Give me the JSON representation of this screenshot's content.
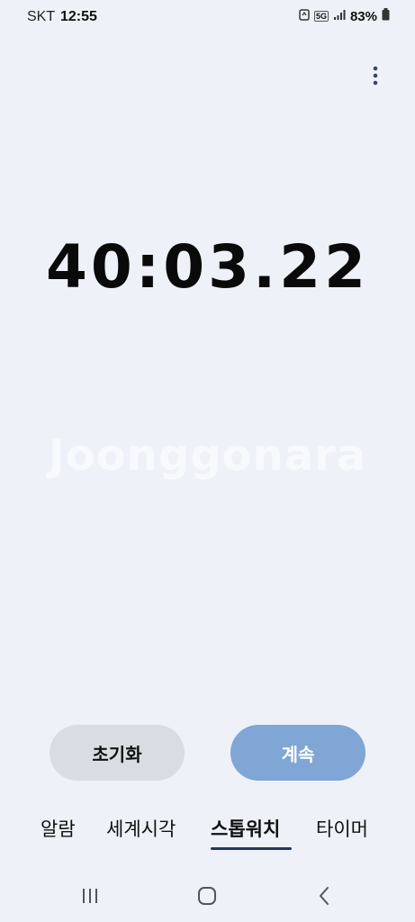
{
  "status_bar": {
    "carrier": "SKT",
    "time": "12:55",
    "network": "5G",
    "battery": "83%"
  },
  "stopwatch": {
    "elapsed": "40:03.22"
  },
  "watermark": "Joonggonara",
  "buttons": {
    "reset_label": "초기화",
    "continue_label": "계속"
  },
  "tabs": [
    {
      "label": "알람",
      "selected": false
    },
    {
      "label": "세계시각",
      "selected": false
    },
    {
      "label": "스톱워치",
      "selected": true
    },
    {
      "label": "타이머",
      "selected": false
    }
  ],
  "icons": {
    "more": "more-vertical-icon",
    "recents": "recent-apps-icon",
    "home": "home-icon",
    "back": "back-icon"
  },
  "colors": {
    "background": "#eef1f8",
    "continue_button": "#7fa6d4",
    "reset_button": "#d9dde3",
    "tab_indicator": "#223a5a"
  }
}
